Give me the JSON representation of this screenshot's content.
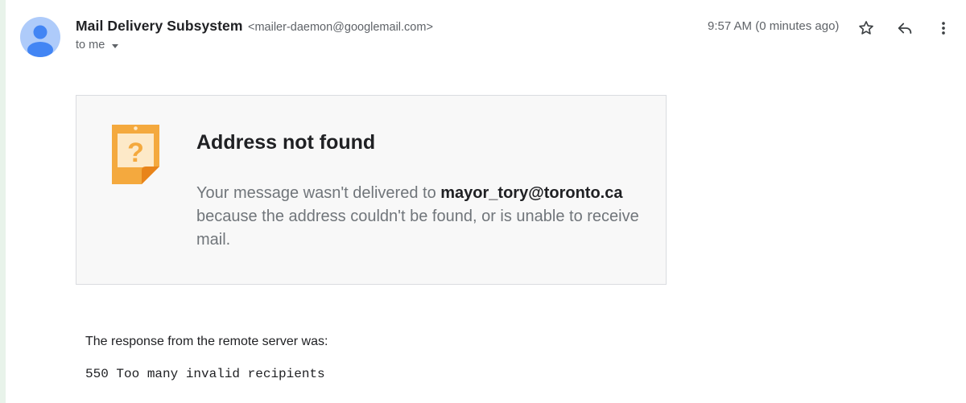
{
  "header": {
    "sender_name": "Mail Delivery Subsystem",
    "sender_email": "<mailer-daemon@googlemail.com>",
    "recipient_label": "to me",
    "timestamp": "9:57 AM (0 minutes ago)"
  },
  "icons": {
    "avatar": "person-avatar-icon",
    "star": "star-outline-icon",
    "reply": "reply-arrow-icon",
    "more": "more-vertical-icon",
    "notice": "question-note-icon"
  },
  "notice": {
    "title": "Address not found",
    "body_prefix": "Your message wasn't delivered to ",
    "recipient": "mayor_tory@toronto.ca",
    "body_suffix": " because the address couldn't be found, or is unable to receive mail."
  },
  "response": {
    "label": "The response from the remote server was:",
    "code": "550 Too many invalid recipients"
  },
  "colors": {
    "avatar_bg": "#aecbfa",
    "avatar_figure": "#4285f4",
    "notice_orange": "#f4a93e",
    "card_bg": "#f8f8f8"
  }
}
